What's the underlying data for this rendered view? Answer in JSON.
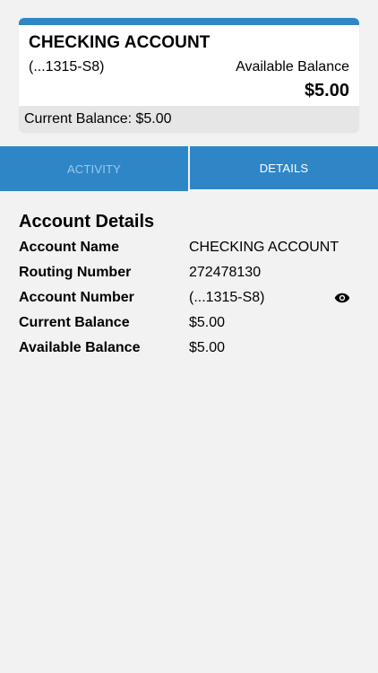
{
  "account_card": {
    "name": "CHECKING ACCOUNT",
    "masked_number": "(...1315-S8)",
    "available_label": "Available Balance",
    "available_amount": "$5.00",
    "current_balance_text": "Current Balance: $5.00"
  },
  "tabs": [
    {
      "label": "ACTIVITY",
      "active": false
    },
    {
      "label": "DETAILS",
      "active": true
    }
  ],
  "details": {
    "title": "Account Details",
    "rows": [
      {
        "label": "Account Name",
        "value": "CHECKING ACCOUNT"
      },
      {
        "label": "Routing Number",
        "value": "272478130"
      },
      {
        "label": "Account Number",
        "value": "(...1315-S8)",
        "icon": "eye-icon"
      },
      {
        "label": "Current Balance",
        "value": "$5.00"
      },
      {
        "label": "Available Balance",
        "value": "$5.00"
      }
    ]
  },
  "colors": {
    "accent": "#2f86c7",
    "background": "#f2f2f2",
    "card": "#ffffff",
    "card_footer": "#e6e6e6"
  }
}
